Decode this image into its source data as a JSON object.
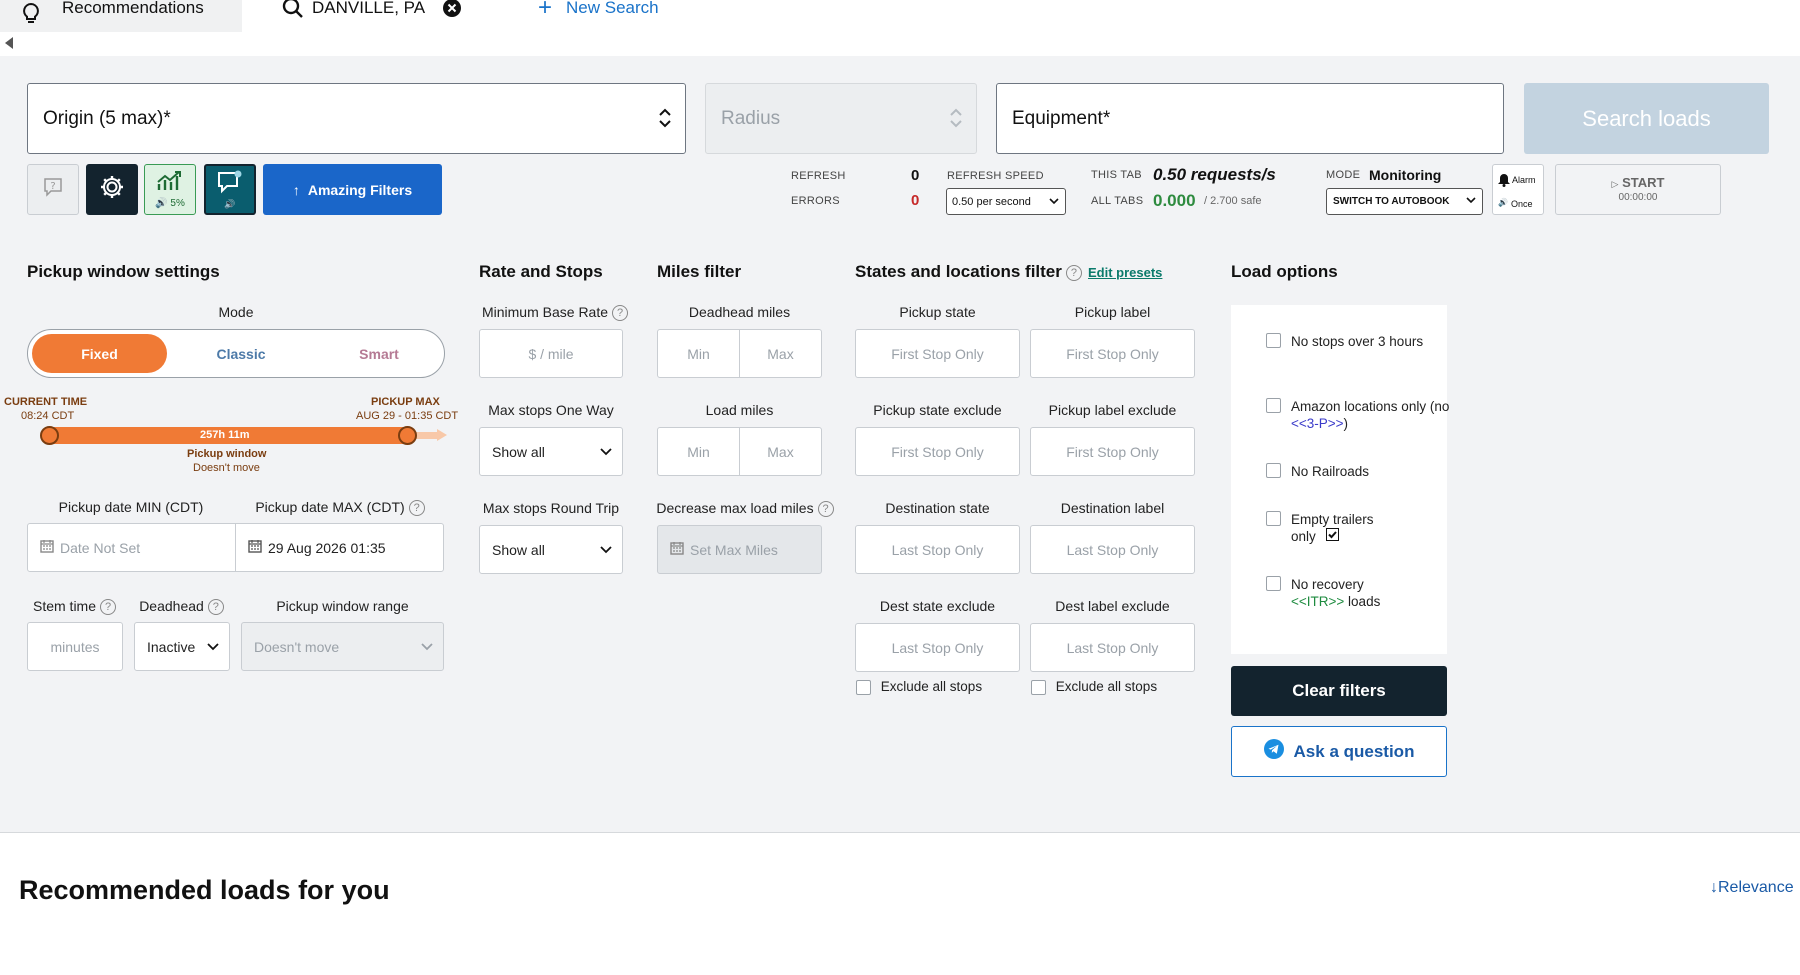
{
  "tabs": {
    "recommendations": "Recommendations",
    "search": "DANVILLE, PA",
    "new_search": "New Search"
  },
  "search": {
    "origin": "Origin (5 max)*",
    "radius": "Radius",
    "equipment": "Equipment*",
    "search_button": "Search loads"
  },
  "toolbar": {
    "percent": "5%",
    "amazing_filters": "Amazing Filters"
  },
  "stats": {
    "refresh_label": "REFRESH",
    "refresh_value": "0",
    "errors_label": "ERRORS",
    "errors_value": "0",
    "refresh_speed_label": "REFRESH SPEED",
    "refresh_speed_value": "0.50 per second",
    "this_tab_label": "THIS TAB",
    "this_tab_value": "0.50 requests/s",
    "all_tabs_label": "ALL TABS",
    "all_tabs_value": "0.000",
    "all_tabs_safe": "/ 2.700 safe",
    "mode_label": "MODE",
    "mode_value": "Monitoring",
    "switch_autobook": "SWITCH TO AUTOBOOK",
    "alarm": "Alarm",
    "once": "Once",
    "start": "START",
    "timer": "00:00:00"
  },
  "pickup": {
    "title": "Pickup window settings",
    "mode_label": "Mode",
    "modes": [
      "Fixed",
      "Classic",
      "Smart"
    ],
    "current_time_label": "CURRENT TIME",
    "current_time": "08:24 CDT",
    "pickup_max_label": "PICKUP MAX",
    "pickup_max": "AUG 29 - 01:35 CDT",
    "duration": "257h 11m",
    "window_label": "Pickup window",
    "window_sub": "Doesn't move",
    "date_min_label": "Pickup date MIN (CDT)",
    "date_max_label": "Pickup date MAX (CDT)",
    "date_min_placeholder": "Date Not Set",
    "date_max_value": "29 Aug 2026 01:35",
    "stem_label": "Stem time",
    "stem_placeholder": "minutes",
    "deadhead_label": "Deadhead",
    "deadhead_value": "Inactive",
    "range_label": "Pickup window range",
    "range_value": "Doesn't move"
  },
  "rate": {
    "title": "Rate and Stops",
    "min_base_label": "Minimum Base Rate",
    "min_base_placeholder": "$ / mile",
    "one_way_label": "Max stops One Way",
    "one_way_value": "Show all",
    "round_trip_label": "Max stops Round Trip",
    "round_trip_value": "Show all"
  },
  "miles": {
    "title": "Miles filter",
    "deadhead_label": "Deadhead miles",
    "load_label": "Load miles",
    "min": "Min",
    "max": "Max",
    "decrease_label": "Decrease max load miles",
    "decrease_placeholder": "Set Max Miles"
  },
  "states": {
    "title": "States and locations filter",
    "edit_presets": "Edit presets",
    "pickup_state": "Pickup state",
    "pickup_label": "Pickup label",
    "pickup_state_exclude": "Pickup state exclude",
    "pickup_label_exclude": "Pickup label exclude",
    "dest_state": "Destination state",
    "dest_label": "Destination label",
    "dest_state_exclude": "Dest state exclude",
    "dest_label_exclude": "Dest label exclude",
    "first_stop": "First Stop Only",
    "last_stop": "Last Stop Only",
    "exclude_all": "Exclude all stops"
  },
  "load_options": {
    "title": "Load options",
    "opt1": "No stops over 3 hours",
    "opt2_a": "Amazon locations only (no ",
    "opt2_b": "<<3-P>>",
    "opt2_c": ")",
    "opt3": "No Railroads",
    "opt4": "Empty trailers only",
    "opt5_a": "No recovery",
    "opt5_b": "<<ITR>>",
    "opt5_c": " loads",
    "clear": "Clear filters",
    "ask": "Ask a question"
  },
  "recommended": {
    "title": "Recommended loads for you",
    "sort": "Relevance"
  },
  "colors": {
    "orange": "#f07a35",
    "dark": "#13232e",
    "blue": "#1a73c9",
    "teal": "#0a5d6e"
  }
}
